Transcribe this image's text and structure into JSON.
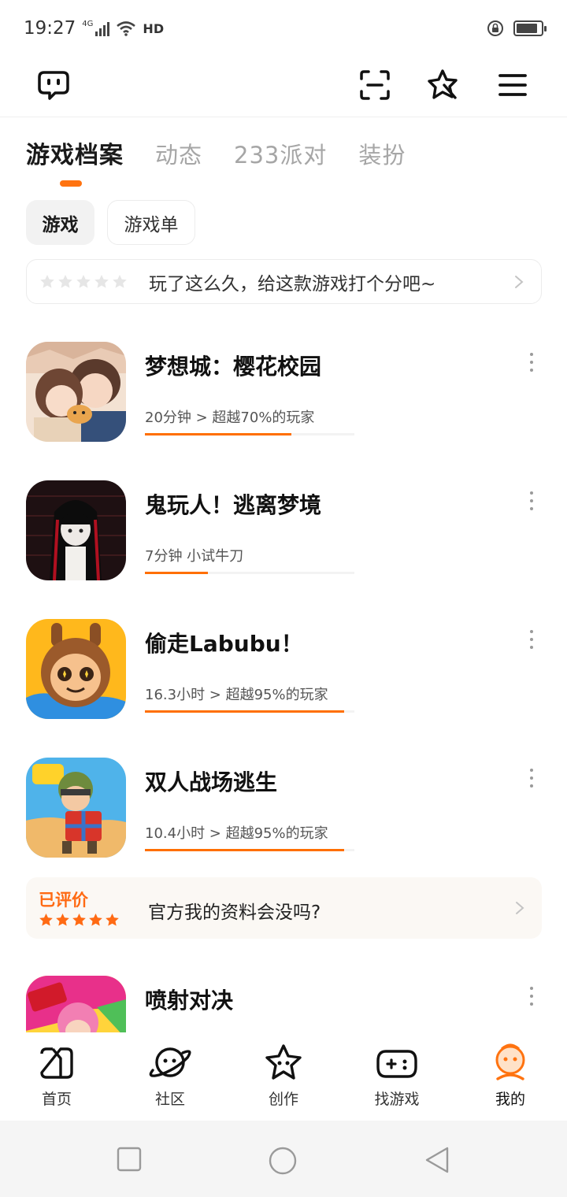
{
  "status_bar": {
    "time": "19:27",
    "network": "4G",
    "hd": "HD",
    "battery_level": 0.85
  },
  "top_bar": {
    "icons": [
      "message-bubble-icon",
      "scan-icon",
      "badge-star-icon",
      "menu-icon"
    ]
  },
  "tabs": [
    {
      "label": "游戏档案",
      "active": true
    },
    {
      "label": "动态",
      "active": false
    },
    {
      "label": "233派对",
      "active": false
    },
    {
      "label": "装扮",
      "active": false
    }
  ],
  "chips": [
    {
      "label": "游戏",
      "active": true
    },
    {
      "label": "游戏单",
      "active": false
    }
  ],
  "rate_prompt": {
    "text": "玩了这么久，给这款游戏打个分吧~",
    "stars": 0,
    "max_stars": 5
  },
  "games": [
    {
      "name": "梦想城：樱花校园",
      "stat": "20分钟 > 超越70%的玩家",
      "progress": 0.7
    },
    {
      "name": "鬼玩人！逃离梦境",
      "stat": "7分钟 小试牛刀",
      "progress": 0.3
    },
    {
      "name": "偷走Labubu！",
      "stat": "16.3小时 > 超越95%的玩家",
      "progress": 0.95
    },
    {
      "name": "双人战场逃生",
      "stat": "10.4小时 > 超越95%的玩家",
      "progress": 0.95
    },
    {
      "name": "喷射对决",
      "stat": "",
      "progress": null
    }
  ],
  "review_card": {
    "tag": "已评价",
    "stars": 5,
    "text": "官方我的资料会没吗?"
  },
  "bottom_nav": [
    {
      "label": "首页",
      "icon": "home-icon"
    },
    {
      "label": "社区",
      "icon": "community-planet-icon"
    },
    {
      "label": "创作",
      "icon": "create-star-icon"
    },
    {
      "label": "找游戏",
      "icon": "gamepad-icon"
    },
    {
      "label": "我的",
      "icon": "profile-face-icon",
      "active": true
    }
  ],
  "colors": {
    "accent": "#ff7310",
    "progress": "#ff6f00",
    "inactive_tab": "#a6a6a6",
    "review_bg": "#fbf8f4"
  }
}
